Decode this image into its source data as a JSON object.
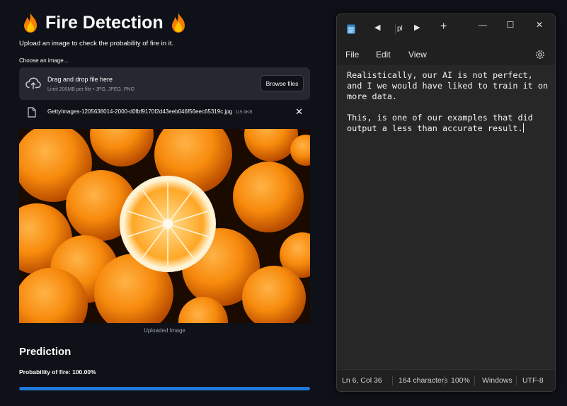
{
  "app": {
    "title": "Fire Detection",
    "subtitle": "Upload an image to check the probability of fire in it.",
    "uploader": {
      "label": "Choose an image...",
      "drop_title": "Drag and drop file here",
      "limit_text": "Limit 200MB per file • JPG, JPEG, PNG",
      "browse_label": "Browse files"
    },
    "file": {
      "name": "GettyImages-1205638014-2000-d0fbf9170f2d43eeb046f56eec65319c.jpg",
      "size": "115.9KB"
    },
    "image_caption": "Uploaded Image",
    "prediction_heading": "Prediction",
    "probability_text": "Probability of fire: 100.00%",
    "progress": 1.0,
    "colors": {
      "progress": "#1f77d8",
      "background": "#0e1117"
    }
  },
  "notepad": {
    "tab_label": "pl",
    "menu": [
      "File",
      "Edit",
      "View"
    ],
    "text": "Realistically, our AI is not perfect, and I we would have liked to train it on more data.\n\nThis, is one of our examples that did output a less than accurate result.",
    "status": {
      "position": "Ln 6, Col 36",
      "characters": "164 characters",
      "zoom": "100%",
      "line_ending": "Windows",
      "encoding": "UTF-8"
    }
  }
}
